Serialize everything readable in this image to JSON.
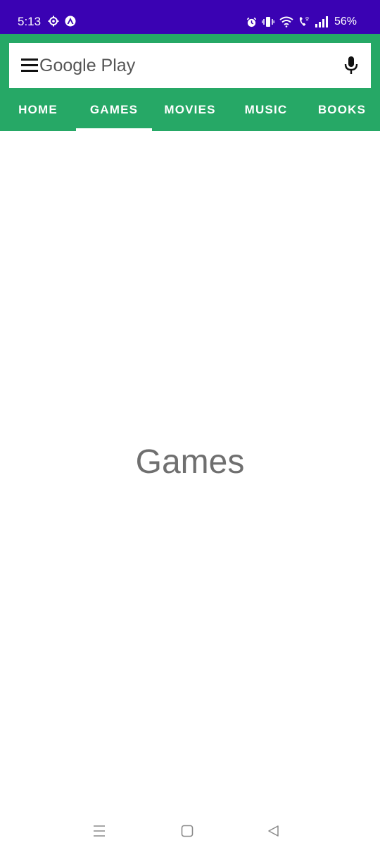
{
  "status_bar": {
    "time": "5:13",
    "battery": "56%",
    "icons": [
      "settings-gear-icon",
      "app-notification-icon",
      "alarm-icon",
      "vibrate-icon",
      "wifi-icon",
      "wifi-calling-icon",
      "signal-icon"
    ],
    "background_color": "#3a02b3"
  },
  "search": {
    "text": "Google Play",
    "menu_icon": "hamburger-menu-icon",
    "mic_icon": "microphone-icon"
  },
  "tabs": [
    {
      "label": "HOME",
      "selected": false
    },
    {
      "label": "GAMES",
      "selected": true
    },
    {
      "label": "MOVIES",
      "selected": false
    },
    {
      "label": "MUSIC",
      "selected": false
    },
    {
      "label": "BOOKS",
      "selected": false
    }
  ],
  "main": {
    "title": "Games"
  },
  "nav_bar": {
    "buttons": [
      "recent-apps-icon",
      "home-icon",
      "back-icon"
    ]
  },
  "colors": {
    "accent": "#26a866",
    "status_bar": "#3a02b3",
    "content_text": "#6f6f6f"
  }
}
